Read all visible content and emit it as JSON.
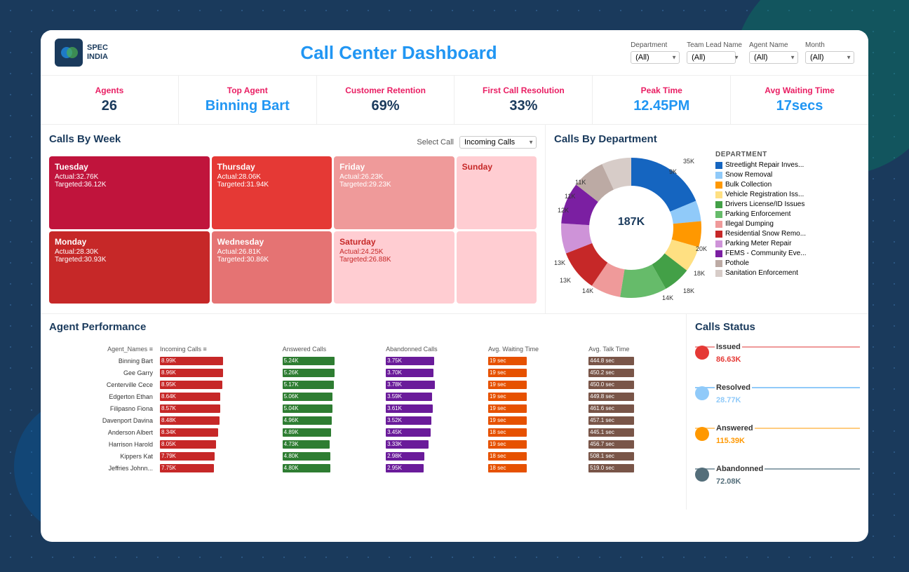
{
  "header": {
    "title": "Call Center Dashboard",
    "logo_line1": "SPEC",
    "logo_line2": "INDIA"
  },
  "filters": {
    "department_label": "Department",
    "department_value": "(All)",
    "team_lead_label": "Team Lead Name",
    "team_lead_value": "(All)",
    "agent_name_label": "Agent Name",
    "agent_name_value": "(All)",
    "month_label": "Month",
    "month_value": "(All)"
  },
  "kpis": {
    "agents_label": "Agents",
    "agents_value": "26",
    "top_agent_label": "Top Agent",
    "top_agent_value": "Binning Bart",
    "customer_retention_label": "Customer Retention",
    "customer_retention_value": "69%",
    "first_call_resolution_label": "First Call Resolution",
    "first_call_resolution_value": "33%",
    "peak_time_label": "Peak Time",
    "peak_time_value": "12.45PM",
    "avg_waiting_label": "Avg Waiting Time",
    "avg_waiting_value": "17secs"
  },
  "calls_by_week": {
    "title": "Calls By Week",
    "select_call_label": "Select Call",
    "select_call_value": "Incoming Calls",
    "days": [
      {
        "name": "Tuesday",
        "actual": "Actual:32.76K",
        "targeted": "Targeted:36.12K",
        "color": "cell-tuesday"
      },
      {
        "name": "Thursday",
        "actual": "Actual:28.06K",
        "targeted": "Targeted:31.94K",
        "color": "cell-thursday"
      },
      {
        "name": "Friday",
        "actual": "Actual:26.23K",
        "targeted": "Targeted:29.23K",
        "color": "cell-friday"
      },
      {
        "name": "Sunday",
        "actual": "",
        "targeted": "",
        "color": "cell-sunday"
      },
      {
        "name": "Monday",
        "actual": "Actual:28.30K",
        "targeted": "Targeted:30.93K",
        "color": "cell-monday"
      },
      {
        "name": "Wednesday",
        "actual": "Actual:26.81K",
        "targeted": "Targeted:30.86K",
        "color": "cell-wednesday"
      },
      {
        "name": "Saturday",
        "actual": "Actual:24.25K",
        "targeted": "Targeted:26.88K",
        "color": "cell-saturday"
      },
      {
        "name": "",
        "actual": "",
        "targeted": "",
        "color": "cell-sunday"
      }
    ]
  },
  "calls_by_dept": {
    "title": "Calls By Department",
    "total": "187K",
    "dept_title": "DEPARTMENT",
    "departments": [
      {
        "name": "Streetlight Repair Inves...",
        "color": "#1565c0",
        "value": 35
      },
      {
        "name": "Snow Removal",
        "color": "#90caf9",
        "value": 9
      },
      {
        "name": "Bulk Collection",
        "color": "#ff9800",
        "value": 11
      },
      {
        "name": "Vehicle Registration Iss...",
        "color": "#ffe082",
        "value": 11
      },
      {
        "name": "Drivers License/ID Issues",
        "color": "#43a047",
        "value": 12
      },
      {
        "name": "Parking Enforcement",
        "color": "#66bb6a",
        "value": 20
      },
      {
        "name": "Illegal Dumping",
        "color": "#ef9a9a",
        "value": 13
      },
      {
        "name": "Residential Snow Remo...",
        "color": "#c62828",
        "value": 18
      },
      {
        "name": "Parking Meter Repair",
        "color": "#ce93d8",
        "value": 13
      },
      {
        "name": "FEMS - Community Eve...",
        "color": "#7b1fa2",
        "value": 18
      },
      {
        "name": "Pothole",
        "color": "#bcaaa4",
        "value": 14
      },
      {
        "name": "Sanitation Enforcement",
        "color": "#d7ccc8",
        "value": 14
      }
    ]
  },
  "agent_performance": {
    "title": "Agent Performance",
    "filter_icon": "≡",
    "columns": [
      "Incoming Calls",
      "Answered Calls",
      "Abandonned Calls",
      "Avg. Waiting Time",
      "Avg. Talk Time"
    ],
    "agents": [
      {
        "name": "Binning Bart",
        "incoming": "8.99K",
        "answered": "5.24K",
        "abandoned": "3.75K",
        "avg_wait": "19 sec",
        "avg_talk": "444.8 sec"
      },
      {
        "name": "Gee Garry",
        "incoming": "8.96K",
        "answered": "5.26K",
        "abandoned": "3.70K",
        "avg_wait": "19 sec",
        "avg_talk": "450.2 sec"
      },
      {
        "name": "Centerville Cece",
        "incoming": "8.95K",
        "answered": "5.17K",
        "abandoned": "3.78K",
        "avg_wait": "19 sec",
        "avg_talk": "450.0 sec"
      },
      {
        "name": "Edgerton Ethan",
        "incoming": "8.64K",
        "answered": "5.06K",
        "abandoned": "3.59K",
        "avg_wait": "19 sec",
        "avg_talk": "449.8 sec"
      },
      {
        "name": "Filipasno Fiona",
        "incoming": "8.57K",
        "answered": "5.04K",
        "abandoned": "3.61K",
        "avg_wait": "19 sec",
        "avg_talk": "461.6 sec"
      },
      {
        "name": "Davenport Davina",
        "incoming": "8.48K",
        "answered": "4.96K",
        "abandoned": "3.52K",
        "avg_wait": "19 sec",
        "avg_talk": "457.1 sec"
      },
      {
        "name": "Anderson Albert",
        "incoming": "8.34K",
        "answered": "4.89K",
        "abandoned": "3.45K",
        "avg_wait": "18 sec",
        "avg_talk": "445.1 sec"
      },
      {
        "name": "Harrison Harold",
        "incoming": "8.05K",
        "answered": "4.73K",
        "abandoned": "3.33K",
        "avg_wait": "19 sec",
        "avg_talk": "456.7 sec"
      },
      {
        "name": "Kippers Kat",
        "incoming": "7.79K",
        "answered": "4.80K",
        "abandoned": "2.98K",
        "avg_wait": "18 sec",
        "avg_talk": "508.1 sec"
      },
      {
        "name": "Jeffries Johnn...",
        "incoming": "7.75K",
        "answered": "4.80K",
        "abandoned": "2.95K",
        "avg_wait": "18 sec",
        "avg_talk": "519.0 sec"
      }
    ]
  },
  "calls_status": {
    "title": "Calls Status",
    "items": [
      {
        "name": "Issued",
        "value": "86.63K",
        "color": "#e53935",
        "line_color": "#ef9a9a"
      },
      {
        "name": "Resolved",
        "value": "28.77K",
        "color": "#90caf9",
        "line_color": "#90caf9"
      },
      {
        "name": "Answered",
        "value": "115.39K",
        "color": "#ff9800",
        "line_color": "#ffcc80"
      },
      {
        "name": "Abandonned",
        "value": "72.08K",
        "color": "#546e7a",
        "line_color": "#90a4ae"
      }
    ]
  }
}
